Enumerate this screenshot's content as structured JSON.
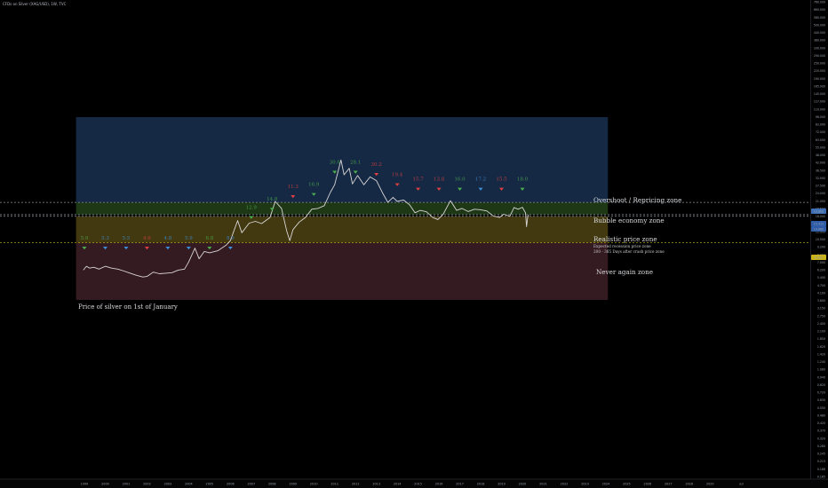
{
  "symbol_header": "CFDs on Silver (XAG/USD), 1W, TVC",
  "chart_data": {
    "type": "line",
    "title": "",
    "xlabel": "",
    "ylabel": "",
    "x_ticks": [
      "1999",
      "2000",
      "2001",
      "2002",
      "2003",
      "2004",
      "2005",
      "2006",
      "2007",
      "2008",
      "2009",
      "2010",
      "2011",
      "2012",
      "2013",
      "2014",
      "2015",
      "2016",
      "2017",
      "2018",
      "2019",
      "2020",
      "2021",
      "2022",
      "2023",
      "2024",
      "2025",
      "2026",
      "2027",
      "2028",
      "2029",
      "Jul"
    ],
    "xlim": [
      1998.6,
      2030.7
    ],
    "y_scale": "log",
    "ylim": [
      0.05,
      200
    ],
    "y_ticks": [
      "760.000",
      "660.000",
      "580.000",
      "500.000",
      "440.000",
      "380.000",
      "330.000",
      "290.000",
      "250.000",
      "220.000",
      "190.000",
      "165.000",
      "145.000",
      "127.000",
      "110.000",
      "96.000",
      "83.000",
      "72.000",
      "63.000",
      "55.000",
      "48.000",
      "42.000",
      "36.500",
      "32.000",
      "27.500",
      "24.000",
      "21.000",
      "18.500",
      "16.000",
      "14.000",
      "12.000",
      "10.500",
      "9.200",
      "8.000",
      "7.000",
      "6.200",
      "5.400",
      "4.700",
      "4.100",
      "3.600",
      "3.150",
      "2.750",
      "2.400",
      "2.100",
      "1.850",
      "1.620",
      "1.420",
      "1.240",
      "1.080",
      "0.940",
      "0.820",
      "0.720",
      "0.630",
      "0.550",
      "0.480",
      "0.420",
      "0.370",
      "0.320",
      "0.280",
      "0.245",
      "0.215",
      "0.188",
      "0.165"
    ],
    "price_labels": [
      {
        "text": "19.800",
        "color": "#3d6fb6",
        "value": 19.8
      },
      {
        "text": "15.412",
        "color": "#2f5da8",
        "value": 15.4
      },
      {
        "text": "14.880",
        "color": "#2f5da8",
        "value": 14.88
      },
      {
        "text": "8.600",
        "color": "#c9b21a",
        "value": 8.6
      }
    ],
    "series": [
      {
        "points": [
          [
            1998.95,
            4.9
          ],
          [
            1999.1,
            5.3
          ],
          [
            1999.25,
            5.1
          ],
          [
            1999.45,
            5.2
          ],
          [
            1999.7,
            5.0
          ],
          [
            2000.0,
            5.3
          ],
          [
            2000.3,
            5.1
          ],
          [
            2000.6,
            5.0
          ],
          [
            2000.9,
            4.8
          ],
          [
            2001.2,
            4.6
          ],
          [
            2001.5,
            4.4
          ],
          [
            2001.8,
            4.25
          ],
          [
            2002.0,
            4.3
          ],
          [
            2002.3,
            4.7
          ],
          [
            2002.6,
            4.55
          ],
          [
            2002.9,
            4.6
          ],
          [
            2003.2,
            4.65
          ],
          [
            2003.5,
            4.9
          ],
          [
            2003.8,
            5.0
          ],
          [
            2004.0,
            5.8
          ],
          [
            2004.3,
            7.7
          ],
          [
            2004.5,
            6.2
          ],
          [
            2004.75,
            7.2
          ],
          [
            2005.0,
            7.0
          ],
          [
            2005.4,
            7.3
          ],
          [
            2005.8,
            8.2
          ],
          [
            2006.0,
            9.0
          ],
          [
            2006.35,
            13.6
          ],
          [
            2006.55,
            10.6
          ],
          [
            2006.9,
            12.9
          ],
          [
            2007.2,
            13.4
          ],
          [
            2007.5,
            12.8
          ],
          [
            2007.9,
            14.5
          ],
          [
            2008.15,
            20.2
          ],
          [
            2008.45,
            17.5
          ],
          [
            2008.7,
            11.0
          ],
          [
            2008.85,
            9.0
          ],
          [
            2009.0,
            11.3
          ],
          [
            2009.3,
            13.2
          ],
          [
            2009.6,
            14.5
          ],
          [
            2009.9,
            17.2
          ],
          [
            2010.2,
            17.5
          ],
          [
            2010.5,
            18.5
          ],
          [
            2010.8,
            24.5
          ],
          [
            2011.0,
            28.5
          ],
          [
            2011.3,
            47.5
          ],
          [
            2011.45,
            35.0
          ],
          [
            2011.7,
            40.0
          ],
          [
            2011.85,
            29.0
          ],
          [
            2012.1,
            34.5
          ],
          [
            2012.4,
            28.5
          ],
          [
            2012.7,
            33.5
          ],
          [
            2013.0,
            31.0
          ],
          [
            2013.3,
            24.0
          ],
          [
            2013.55,
            19.8
          ],
          [
            2013.8,
            22.0
          ],
          [
            2014.0,
            20.2
          ],
          [
            2014.3,
            20.8
          ],
          [
            2014.6,
            18.8
          ],
          [
            2014.85,
            16.0
          ],
          [
            2015.1,
            16.8
          ],
          [
            2015.4,
            16.3
          ],
          [
            2015.7,
            14.5
          ],
          [
            2015.95,
            13.9
          ],
          [
            2016.2,
            15.5
          ],
          [
            2016.55,
            20.5
          ],
          [
            2016.85,
            16.8
          ],
          [
            2017.1,
            17.5
          ],
          [
            2017.4,
            16.4
          ],
          [
            2017.7,
            17.2
          ],
          [
            2018.0,
            17.0
          ],
          [
            2018.3,
            16.6
          ],
          [
            2018.6,
            15.0
          ],
          [
            2018.9,
            14.5
          ],
          [
            2019.1,
            15.5
          ],
          [
            2019.4,
            14.9
          ],
          [
            2019.6,
            17.8
          ],
          [
            2019.8,
            17.2
          ],
          [
            2020.0,
            17.9
          ],
          [
            2020.15,
            16.0
          ],
          [
            2020.2,
            12.0
          ],
          [
            2020.25,
            14.5
          ],
          [
            2020.3,
            15.4
          ]
        ]
      }
    ],
    "zones": [
      {
        "name": "Overshoot / Repricing zone",
        "from": 19.8,
        "to": 115,
        "color": "#1a3050"
      },
      {
        "name": "Bubble economy zone",
        "from": 15.412,
        "to": 19.8,
        "color": "#23421a"
      },
      {
        "name": "Realistic price zone",
        "from": 8.6,
        "to": 14.88,
        "color": "#4e4314",
        "sub1": "Expected recession price zone",
        "sub2": "200 - 365 Days after crash price zone"
      },
      {
        "name": "Never again zone",
        "from": 2.65,
        "to": 8.6,
        "color": "#3d1f27"
      }
    ],
    "zone_x_range": [
      1998.6,
      2024.1
    ],
    "bottom_note": "Price of silver on 1st of January",
    "markers": [
      {
        "x": 1999.0,
        "price": 5.9,
        "label": "5.9",
        "color": "#4cae4c",
        "dir": "down",
        "label_value": 9.2
      },
      {
        "x": 2000.0,
        "price": 5.3,
        "label": "5.3",
        "color": "#3b8fd9",
        "dir": "down",
        "label_value": 9.2
      },
      {
        "x": 2001.0,
        "price": 5.5,
        "label": "5.5",
        "color": "#3b8fd9",
        "dir": "down",
        "label_value": 9.2
      },
      {
        "x": 2002.0,
        "price": 4.6,
        "label": "4.6",
        "color": "#e04040",
        "dir": "down",
        "label_value": 9.2
      },
      {
        "x": 2003.0,
        "price": 4.8,
        "label": "4.8",
        "color": "#3b8fd9",
        "dir": "down",
        "label_value": 9.2
      },
      {
        "x": 2004.0,
        "price": 5.9,
        "label": "5.9",
        "color": "#3b8fd9",
        "dir": "down",
        "label_value": 9.2
      },
      {
        "x": 2005.0,
        "price": 6.8,
        "label": "6.8",
        "color": "#4cae4c",
        "dir": "down",
        "label_value": 9.2
      },
      {
        "x": 2006.0,
        "price": 8.9,
        "label": "8.9",
        "color": "#3b8fd9",
        "dir": "down",
        "label_value": 9.2
      },
      {
        "x": 2007.0,
        "price": 12.9,
        "label": "12.9",
        "color": "#4cae4c",
        "dir": "down",
        "label_value": 17.3
      },
      {
        "x": 2008.0,
        "price": 14.8,
        "label": "14.8",
        "color": "#4cae4c",
        "dir": "down",
        "label_value": 20.5
      },
      {
        "x": 2009.0,
        "price": 11.3,
        "label": "11.3",
        "color": "#e04040",
        "dir": "down",
        "label_value": 26.6
      },
      {
        "x": 2010.0,
        "price": 16.9,
        "label": "16.9",
        "color": "#4cae4c",
        "dir": "down",
        "label_value": 27.8
      },
      {
        "x": 2011.0,
        "price": 30.6,
        "label": "30.6",
        "color": "#4cae4c",
        "dir": "down",
        "label_value": 44.0
      },
      {
        "x": 2012.0,
        "price": 28.1,
        "label": "28.1",
        "color": "#4cae4c",
        "dir": "down",
        "label_value": 44.0
      },
      {
        "x": 2013.0,
        "price": 30.2,
        "label": "30.2",
        "color": "#e04040",
        "dir": "down",
        "label_value": 42.0
      },
      {
        "x": 2014.0,
        "price": 19.4,
        "label": "19.4",
        "color": "#e04040",
        "dir": "down",
        "label_value": 34.0
      },
      {
        "x": 2015.0,
        "price": 15.7,
        "label": "15.7",
        "color": "#e04040",
        "dir": "down",
        "label_value": 31.0
      },
      {
        "x": 2016.0,
        "price": 13.8,
        "label": "13.8",
        "color": "#e04040",
        "dir": "down",
        "label_value": 31.0
      },
      {
        "x": 2017.0,
        "price": 16.0,
        "label": "16.0",
        "color": "#4cae4c",
        "dir": "down",
        "label_value": 31.0
      },
      {
        "x": 2018.0,
        "price": 17.2,
        "label": "17.2",
        "color": "#3b8fd9",
        "dir": "down",
        "label_value": 31.0
      },
      {
        "x": 2019.0,
        "price": 15.5,
        "label": "15.5",
        "color": "#e04040",
        "dir": "down",
        "label_value": 31.0
      },
      {
        "x": 2020.0,
        "price": 18.0,
        "label": "18.0",
        "color": "#4cae4c",
        "dir": "down",
        "label_value": 31.0
      }
    ]
  }
}
